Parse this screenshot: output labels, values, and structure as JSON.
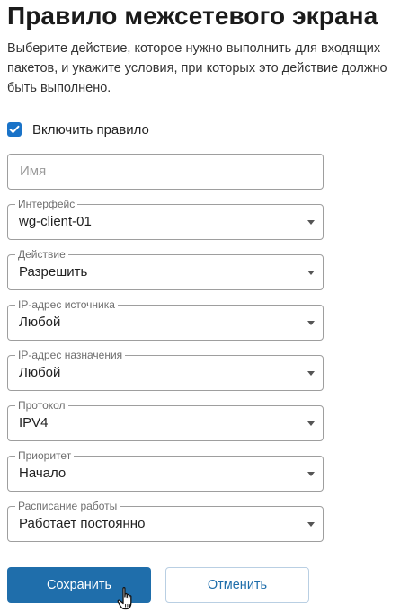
{
  "dialog": {
    "title": "Правило межсетевого экрана",
    "description": "Выберите действие, которое нужно выполнить для входящих пакетов, и укажите условия, при которых это действие должно быть выполнено."
  },
  "enable_rule": {
    "label": "Включить правило",
    "checked": true
  },
  "name_field": {
    "placeholder": "Имя",
    "value": ""
  },
  "interface": {
    "label": "Интерфейс",
    "value": "wg-client-01"
  },
  "action": {
    "label": "Действие",
    "value": "Разрешить"
  },
  "source_ip": {
    "label": "IP-адрес источника",
    "value": "Любой"
  },
  "destination_ip": {
    "label": "IP-адрес назначения",
    "value": "Любой"
  },
  "protocol": {
    "label": "Протокол",
    "value": "IPV4"
  },
  "priority": {
    "label": "Приоритет",
    "value": "Начало"
  },
  "schedule": {
    "label": "Расписание работы",
    "value": "Работает постоянно"
  },
  "buttons": {
    "save": "Сохранить",
    "cancel": "Отменить"
  },
  "colors": {
    "accent": "#1f6eab",
    "checkbox": "#1a73c8",
    "border": "#9e9e9e"
  },
  "icons": {
    "checkbox": "check-icon",
    "dropdown": "chevron-down-icon",
    "cursor": "hand-pointer-icon"
  }
}
